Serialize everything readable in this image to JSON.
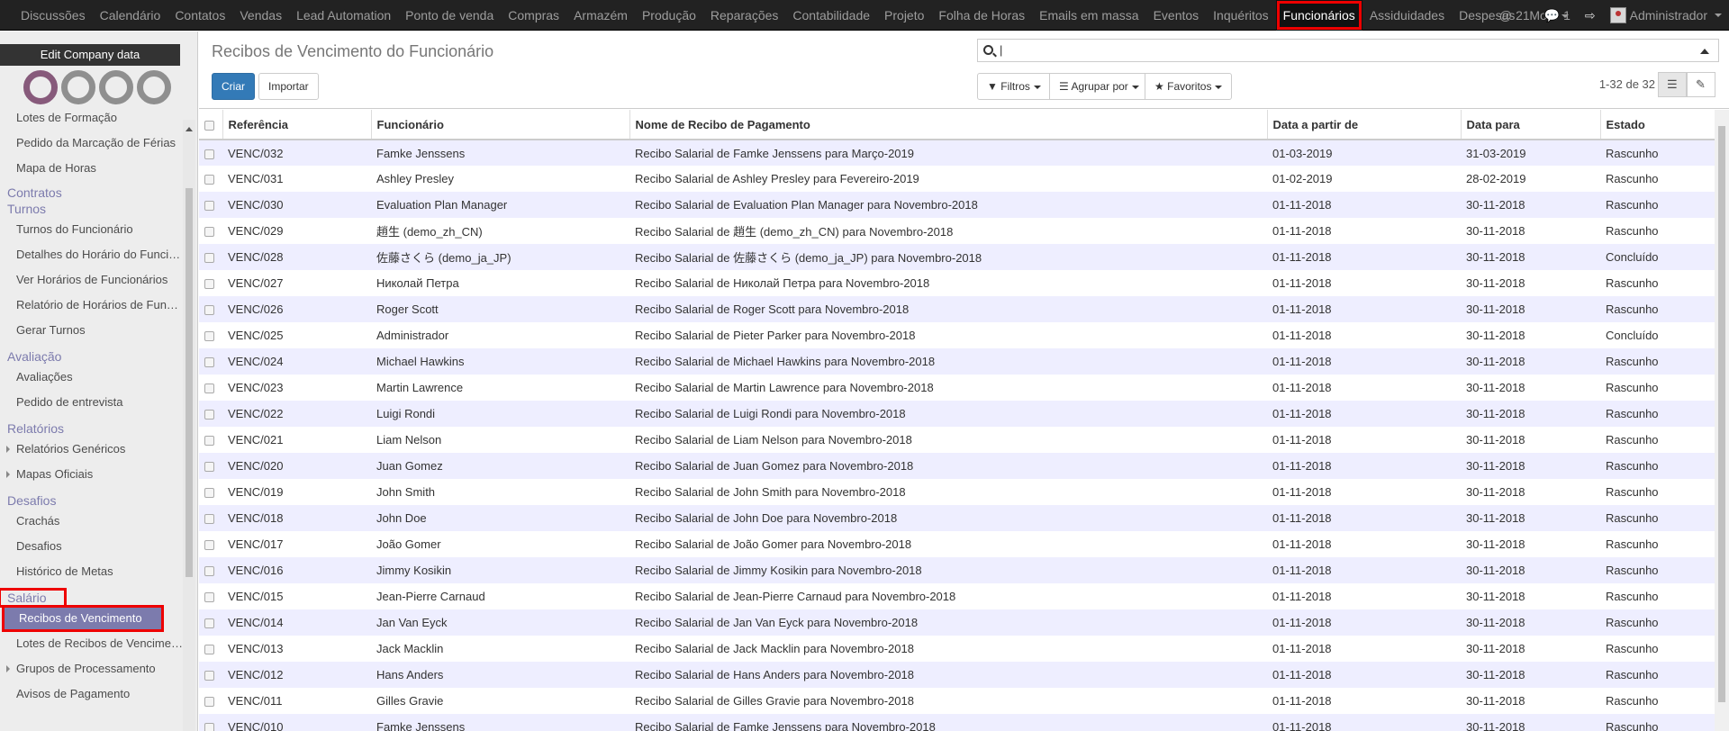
{
  "topmenu": [
    "Discussões",
    "Calendário",
    "Contatos",
    "Vendas",
    "Lead Automation",
    "Ponto de venda",
    "Compras",
    "Armazém",
    "Produção",
    "Reparações",
    "Contabilidade",
    "Projeto",
    "Folha de Horas",
    "Emails em massa",
    "Eventos",
    "Inquéritos",
    "Funcionários",
    "Assiduidades",
    "Despesas"
  ],
  "more_label": "More",
  "top_right": {
    "mentions": "21",
    "messages": "1",
    "user": "Administrador"
  },
  "sidebar": {
    "edit_company": "Edit Company data",
    "sections": [
      {
        "header": "",
        "items": [
          {
            "label": "Lotes de Formação",
            "tri": false
          },
          {
            "label": "Pedido da Marcação de Férias",
            "tri": false
          },
          {
            "label": "Mapa de Horas",
            "tri": false
          }
        ]
      },
      {
        "header": "Contratos",
        "items": []
      },
      {
        "header": "Turnos",
        "items": [
          {
            "label": "Turnos do Funcionário",
            "tri": false
          },
          {
            "label": "Detalhes do Horário do Funcionário",
            "tri": false
          },
          {
            "label": "Ver Horários de Funcionários",
            "tri": false
          },
          {
            "label": "Relatório de Horários de Funcionários",
            "tri": false
          },
          {
            "label": "Gerar Turnos",
            "tri": false
          }
        ]
      },
      {
        "header": "Avaliação",
        "items": [
          {
            "label": "Avaliações",
            "tri": false
          },
          {
            "label": "Pedido de entrevista",
            "tri": false
          }
        ]
      },
      {
        "header": "Relatórios",
        "items": [
          {
            "label": "Relatórios Genéricos",
            "tri": true
          },
          {
            "label": "Mapas Oficiais",
            "tri": true
          }
        ]
      },
      {
        "header": "Desafios",
        "items": [
          {
            "label": "Crachás",
            "tri": false
          },
          {
            "label": "Desafios",
            "tri": false
          },
          {
            "label": "Histórico de Metas",
            "tri": false
          }
        ]
      },
      {
        "header": "Salário",
        "items": [
          {
            "label": "Recibos de Vencimento",
            "tri": false,
            "selected": true
          },
          {
            "label": "Lotes de Recibos de Vencimento",
            "tri": false
          },
          {
            "label": "Grupos de Processamento",
            "tri": true
          },
          {
            "label": "Avisos de Pagamento",
            "tri": false
          }
        ]
      }
    ]
  },
  "control": {
    "title": "Recibos de Vencimento do Funcionário",
    "create": "Criar",
    "import": "Importar",
    "filters": "Filtros",
    "group_by": "Agrupar por",
    "favorites": "Favoritos",
    "pager": "1-32 de 32",
    "search_value": "|"
  },
  "table": {
    "columns": [
      "Referência",
      "Funcionário",
      "Nome de Recibo de Pagamento",
      "Data a partir de",
      "Data para",
      "Estado"
    ],
    "rows": [
      [
        "VENC/032",
        "Famke Jenssens",
        "Recibo Salarial de Famke Jenssens para Março-2019",
        "01-03-2019",
        "31-03-2019",
        "Rascunho"
      ],
      [
        "VENC/031",
        "Ashley Presley",
        "Recibo Salarial de Ashley Presley para Fevereiro-2019",
        "01-02-2019",
        "28-02-2019",
        "Rascunho"
      ],
      [
        "VENC/030",
        "Evaluation Plan Manager",
        "Recibo Salarial de Evaluation Plan Manager para Novembro-2018",
        "01-11-2018",
        "30-11-2018",
        "Rascunho"
      ],
      [
        "VENC/029",
        "趙生 (demo_zh_CN)",
        "Recibo Salarial de 趙生 (demo_zh_CN) para Novembro-2018",
        "01-11-2018",
        "30-11-2018",
        "Rascunho"
      ],
      [
        "VENC/028",
        "佐藤さくら (demo_ja_JP)",
        "Recibo Salarial de 佐藤さくら (demo_ja_JP) para Novembro-2018",
        "01-11-2018",
        "30-11-2018",
        "Concluído"
      ],
      [
        "VENC/027",
        "Николай Петра",
        "Recibo Salarial de Николай Петра para Novembro-2018",
        "01-11-2018",
        "30-11-2018",
        "Rascunho"
      ],
      [
        "VENC/026",
        "Roger Scott",
        "Recibo Salarial de Roger Scott para Novembro-2018",
        "01-11-2018",
        "30-11-2018",
        "Rascunho"
      ],
      [
        "VENC/025",
        "Administrador",
        "Recibo Salarial de Pieter Parker para Novembro-2018",
        "01-11-2018",
        "30-11-2018",
        "Concluído"
      ],
      [
        "VENC/024",
        "Michael Hawkins",
        "Recibo Salarial de Michael Hawkins para Novembro-2018",
        "01-11-2018",
        "30-11-2018",
        "Rascunho"
      ],
      [
        "VENC/023",
        "Martin Lawrence",
        "Recibo Salarial de Martin Lawrence para Novembro-2018",
        "01-11-2018",
        "30-11-2018",
        "Rascunho"
      ],
      [
        "VENC/022",
        "Luigi Rondi",
        "Recibo Salarial de Luigi Rondi para Novembro-2018",
        "01-11-2018",
        "30-11-2018",
        "Rascunho"
      ],
      [
        "VENC/021",
        "Liam Nelson",
        "Recibo Salarial de Liam Nelson para Novembro-2018",
        "01-11-2018",
        "30-11-2018",
        "Rascunho"
      ],
      [
        "VENC/020",
        "Juan Gomez",
        "Recibo Salarial de Juan Gomez para Novembro-2018",
        "01-11-2018",
        "30-11-2018",
        "Rascunho"
      ],
      [
        "VENC/019",
        "John Smith",
        "Recibo Salarial de John Smith para Novembro-2018",
        "01-11-2018",
        "30-11-2018",
        "Rascunho"
      ],
      [
        "VENC/018",
        "John Doe",
        "Recibo Salarial de John Doe para Novembro-2018",
        "01-11-2018",
        "30-11-2018",
        "Rascunho"
      ],
      [
        "VENC/017",
        "João Gomer",
        "Recibo Salarial de João Gomer para Novembro-2018",
        "01-11-2018",
        "30-11-2018",
        "Rascunho"
      ],
      [
        "VENC/016",
        "Jimmy Kosikin",
        "Recibo Salarial de Jimmy Kosikin para Novembro-2018",
        "01-11-2018",
        "30-11-2018",
        "Rascunho"
      ],
      [
        "VENC/015",
        "Jean-Pierre Carnaud",
        "Recibo Salarial de Jean-Pierre Carnaud para Novembro-2018",
        "01-11-2018",
        "30-11-2018",
        "Rascunho"
      ],
      [
        "VENC/014",
        "Jan Van Eyck",
        "Recibo Salarial de Jan Van Eyck para Novembro-2018",
        "01-11-2018",
        "30-11-2018",
        "Rascunho"
      ],
      [
        "VENC/013",
        "Jack Macklin",
        "Recibo Salarial de Jack Macklin para Novembro-2018",
        "01-11-2018",
        "30-11-2018",
        "Rascunho"
      ],
      [
        "VENC/012",
        "Hans Anders",
        "Recibo Salarial de Hans Anders para Novembro-2018",
        "01-11-2018",
        "30-11-2018",
        "Rascunho"
      ],
      [
        "VENC/011",
        "Gilles Gravie",
        "Recibo Salarial de Gilles Gravie para Novembro-2018",
        "01-11-2018",
        "30-11-2018",
        "Rascunho"
      ],
      [
        "VENC/010",
        "Famke Jenssens",
        "Recibo Salarial de Famke Jenssens para Novembro-2018",
        "01-11-2018",
        "30-11-2018",
        "Rascunho"
      ]
    ]
  }
}
